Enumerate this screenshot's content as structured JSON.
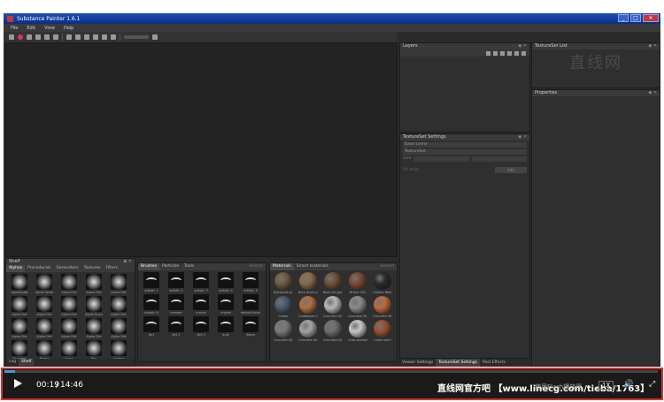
{
  "window": {
    "title": "Substance Painter 1.6.1",
    "buttons": [
      "_",
      "□",
      "✕"
    ]
  },
  "menu": [
    "File",
    "Edit",
    "View",
    "Help"
  ],
  "panels": {
    "layers": {
      "title": "Layers"
    },
    "texture_set_list": {
      "title": "TextureSet List"
    },
    "properties": {
      "title": "Properties"
    },
    "texture_set_settings": {
      "title": "TextureSet Settings",
      "rows": [
        "Base scene",
        "TextureSet"
      ],
      "resolution_label": "Size",
      "uv_label": "UV map",
      "button": "Add"
    },
    "bottom_tabs": [
      "Viewer Settings",
      "TextureSet Settings",
      "Post Effects"
    ]
  },
  "shelf_left": {
    "title": "Shelf",
    "tabs": [
      "Alphas",
      "Procedurals",
      "Generators",
      "Textures",
      "Filters"
    ],
    "footer_tabs": [
      "Log",
      "Shelf"
    ],
    "items": [
      "AlphaSpatt",
      "Alpha Splat",
      "Alpha Dirt",
      "Alpha Dirt",
      "Alpha Dirt",
      "Alpha Dirt",
      "Alpha Dirt",
      "Alpha Dirt",
      "Alpha Bush",
      "Alpha Dirt",
      "Alpha Dirt",
      "Alpha Dirt",
      "Alpha Dirt",
      "Alpha Dirt",
      "Alpha Dirt",
      "Gaussian",
      "Rivets",
      "Grass",
      "Pen",
      "Spiders"
    ]
  },
  "shelf_brushes": {
    "tabs": [
      "Brushes",
      "Particles",
      "Tools"
    ],
    "search": "Search",
    "items": [
      "artistic 1",
      "artistic 2",
      "artistic 3",
      "artistic 4",
      "artistic 5",
      "artistic 6",
      "cement",
      "cracks",
      "crystal",
      "default brush",
      "dirt",
      "dirt 2",
      "dirt 3",
      "dust",
      "fibers"
    ]
  },
  "shelf_materials": {
    "tabs": [
      "Materials",
      "Smart materials"
    ],
    "search": "Search",
    "items": [
      "Backyard gr.",
      "Bark black p.",
      "Bark old gro.",
      "Bricks 001",
      "Carbon fiber",
      "Cinder",
      "Cardboard 0.",
      "Concrete 00.",
      "Concrete 00.",
      "Concrete 00.",
      "Concrete 00.",
      "Concrete 00.",
      "Concrete 00.",
      "Crab seafoam",
      "Crate steel"
    ],
    "colors": [
      "#6f5a42",
      "#8a6a4a",
      "#6d5037",
      "#7a4a30",
      "#2a2a2a",
      "#4a5a6a",
      "#b07040",
      "#b8b8b8",
      "#8a8a8a",
      "#c06a3a",
      "#7a7a7a",
      "#a4a4a4",
      "#6e6e6e",
      "#c8c8c8",
      "#9a5030"
    ]
  },
  "player": {
    "time_current": "00:19",
    "time_separator": "/",
    "time_total": "14:46",
    "watermark": "直线网官方吧 【www.linecg.com/tieba/1763】",
    "speed_label": "使用Flash播放器",
    "quality": "1X"
  },
  "watermark_top": "直线网",
  "colors": {
    "player_border": "#d9342b",
    "progress": "#2aa5e6",
    "titlebar": "#0a2e86"
  }
}
